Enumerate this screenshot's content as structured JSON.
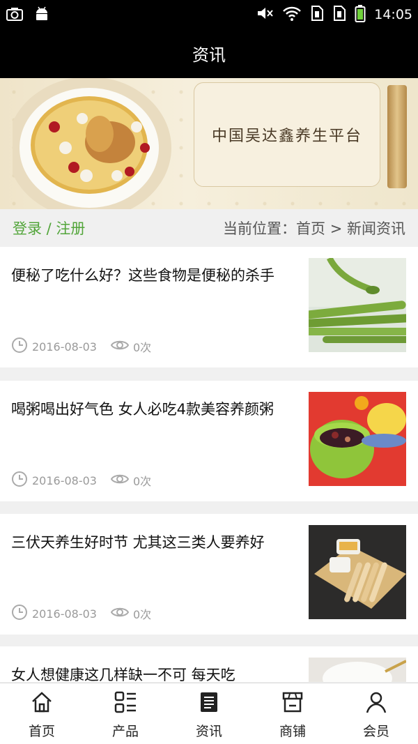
{
  "status_bar": {
    "time": "14:05",
    "icons": [
      "camera-icon",
      "android-icon",
      "mute-icon",
      "wifi-icon",
      "sim1-icon",
      "sim2-icon",
      "battery-icon"
    ]
  },
  "header": {
    "title": "资讯"
  },
  "banner": {
    "title": "中国吴达鑫养生平台"
  },
  "location_bar": {
    "auth": "登录 / 注册",
    "breadcrumb": "当前位置：首页 > 新闻资讯"
  },
  "articles": [
    {
      "title": "便秘了吃什么好？这些食物是便秘的杀手",
      "date": "2016-08-03",
      "views": "0次",
      "thumb": "asparagus-photo"
    },
    {
      "title": "喝粥喝出好气色 女人必吃4款美容养颜粥",
      "date": "2016-08-03",
      "views": "0次",
      "thumb": "congee-photo"
    },
    {
      "title": "三伏天养生好时节 尤其这三类人要养好",
      "date": "2016-08-03",
      "views": "0次",
      "thumb": "breadsticks-photo"
    },
    {
      "title": "女人想健康这几样缺一不可 每天吃",
      "date": "",
      "views": "",
      "thumb": "milk-photo"
    }
  ],
  "tabs": [
    {
      "label": "首页",
      "icon": "home-icon"
    },
    {
      "label": "产品",
      "icon": "grid-list-icon"
    },
    {
      "label": "资讯",
      "icon": "document-icon"
    },
    {
      "label": "商铺",
      "icon": "store-icon"
    },
    {
      "label": "会员",
      "icon": "user-icon"
    }
  ],
  "colors": {
    "accent_green": "#52a53a",
    "bar_black": "#000000"
  }
}
